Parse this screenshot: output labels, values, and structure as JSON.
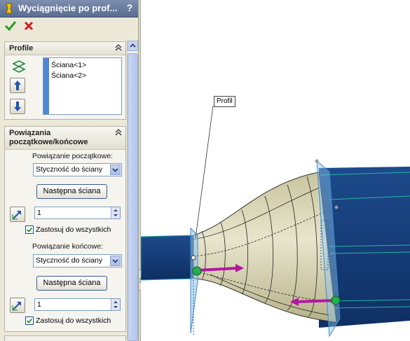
{
  "window": {
    "title": "Wyciągnięcie po prof...",
    "help_label": "?",
    "title_icon": "loft-icon"
  },
  "actions": {
    "ok_icon": "checkmark-icon",
    "cancel_icon": "x-icon"
  },
  "profiles_group": {
    "title": "Profile",
    "items": [
      "Ściana<1>",
      "Ściana<2>"
    ]
  },
  "constraints_group": {
    "title_line1": "Powiązania",
    "title_line2": "początkowe/końcowe",
    "start": {
      "label": "Powiązanie początkowe:",
      "selected": "Styczność do ściany",
      "next_button": "Następna ściana",
      "value": "1",
      "apply_all_label": "Zastosuj do wszystkich",
      "apply_all_checked": true
    },
    "end": {
      "label": "Powiązanie końcowe:",
      "selected": "Styczność do ściany",
      "next_button": "Następna ściana",
      "value": "1",
      "apply_all_label": "Zastosuj do wszystkich",
      "apply_all_checked": true
    }
  },
  "viewport": {
    "callout": "Profil",
    "colors": {
      "solid": "#163d7a",
      "loft": "#d8d4b4",
      "arrow": "#b4169e",
      "handle": "#22b04b"
    }
  }
}
